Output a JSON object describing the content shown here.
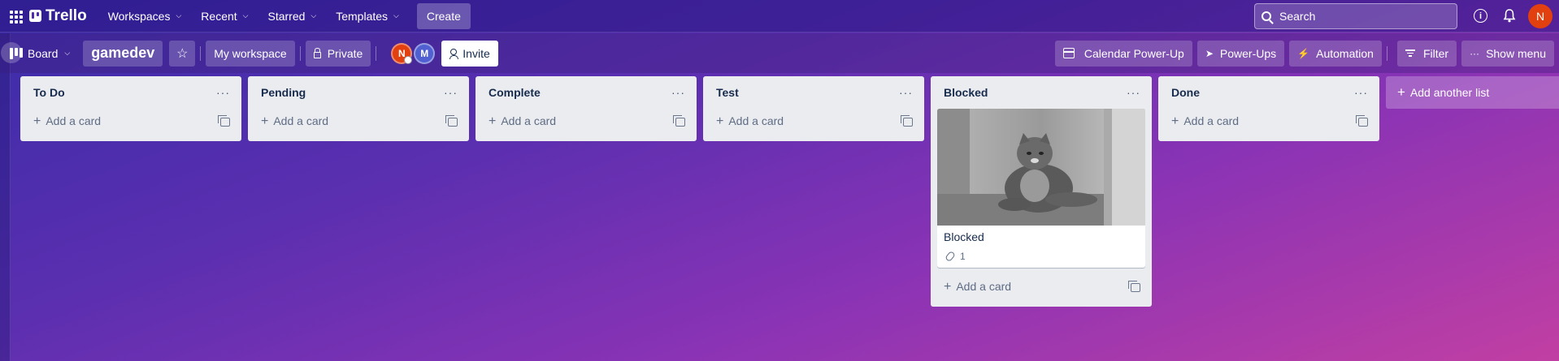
{
  "topnav": {
    "brand": "Trello",
    "items": [
      {
        "label": "Workspaces"
      },
      {
        "label": "Recent"
      },
      {
        "label": "Starred"
      },
      {
        "label": "Templates"
      }
    ],
    "create_label": "Create",
    "search_placeholder": "Search",
    "user_initial": "N"
  },
  "board": {
    "view_label": "Board",
    "title": "gamedev",
    "workspace_label": "My workspace",
    "visibility_label": "Private",
    "members": [
      {
        "initial": "N"
      },
      {
        "initial": "M"
      }
    ],
    "invite_label": "Invite",
    "right_buttons": {
      "calendar": "Calendar Power-Up",
      "powerups": "Power-Ups",
      "automation": "Automation",
      "filter": "Filter",
      "show_menu": "Show menu"
    }
  },
  "lists": [
    {
      "title": "To Do",
      "add_card_label": "Add a card"
    },
    {
      "title": "Pending",
      "add_card_label": "Add a card"
    },
    {
      "title": "Complete",
      "add_card_label": "Add a card"
    },
    {
      "title": "Test",
      "add_card_label": "Add a card"
    },
    {
      "title": "Blocked",
      "add_card_label": "Add a card",
      "card": {
        "title": "Blocked",
        "attachments": "1"
      }
    },
    {
      "title": "Done",
      "add_card_label": "Add a card"
    }
  ],
  "add_list_label": "Add another list",
  "colors": {
    "accent": "#4e2bab",
    "avatar_n": "#e3400f",
    "avatar_m": "#5060d0",
    "list_bg": "#ebecf0"
  }
}
